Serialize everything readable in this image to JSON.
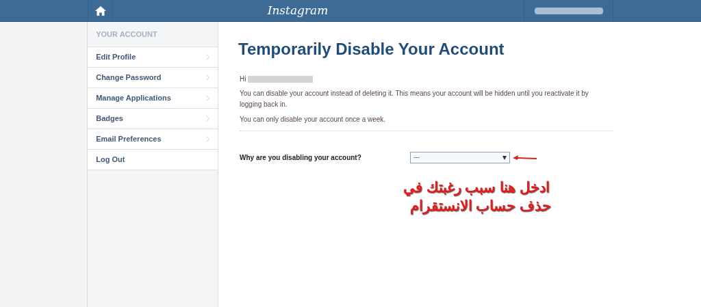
{
  "header": {
    "logo": "Instagram"
  },
  "sidebar": {
    "heading": "YOUR ACCOUNT",
    "items": [
      {
        "label": "Edit Profile",
        "chevron": true
      },
      {
        "label": "Change Password",
        "chevron": true
      },
      {
        "label": "Manage Applications",
        "chevron": true
      },
      {
        "label": "Badges",
        "chevron": true
      },
      {
        "label": "Email Preferences",
        "chevron": true
      },
      {
        "label": "Log Out",
        "chevron": false
      }
    ]
  },
  "main": {
    "title": "Temporarily Disable Your Account",
    "greeting": "Hi",
    "paragraphs": [
      "You can disable your account instead of deleting it. This means your account will be hidden until you reactivate it by logging back in.",
      "You can only disable your account once a week."
    ],
    "question": "Why are you disabling your account?",
    "select_value": "---"
  },
  "annotation": {
    "lines": [
      "ادخل هنا سبب رغبتك في",
      "حذف حساب الانستقرام"
    ]
  }
}
